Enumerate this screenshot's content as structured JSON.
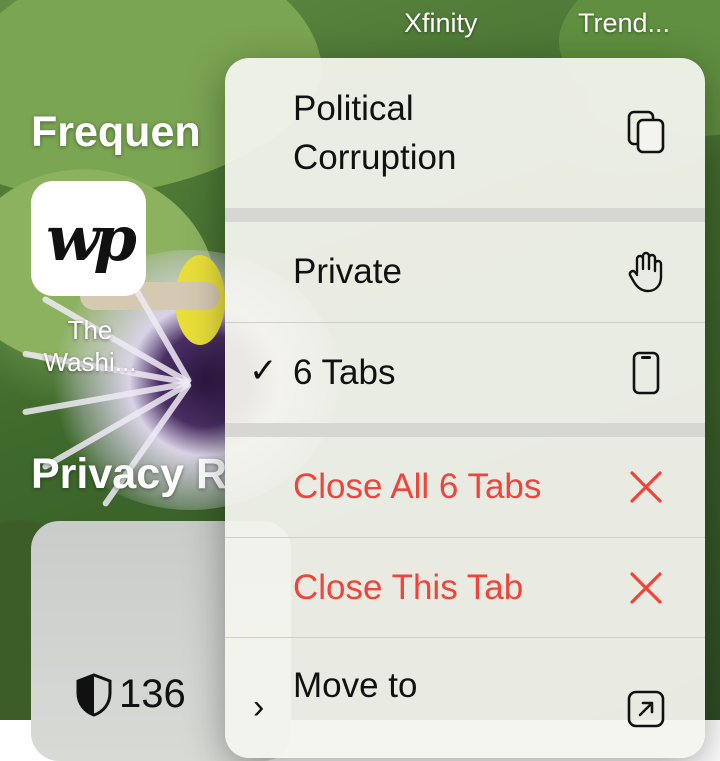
{
  "favorites": {
    "labels": [
      "Xfinity",
      "Trend..."
    ]
  },
  "frequently_visited": {
    "title": "Frequen",
    "tile_caption_1": "The",
    "tile_caption_2": "Washi..."
  },
  "privacy_report": {
    "title": "Privacy R",
    "tracker_count": "136"
  },
  "menu": {
    "group_name_line1": "Political",
    "group_name_line2": "Corruption",
    "private_label": "Private",
    "tabs_label": "6 Tabs",
    "checkmark": "✓",
    "close_all_label": "Close All 6 Tabs",
    "close_this_label": "Close This Tab",
    "move_to_label": "Move to",
    "chevron": "›",
    "close_color": "#f0443a"
  }
}
